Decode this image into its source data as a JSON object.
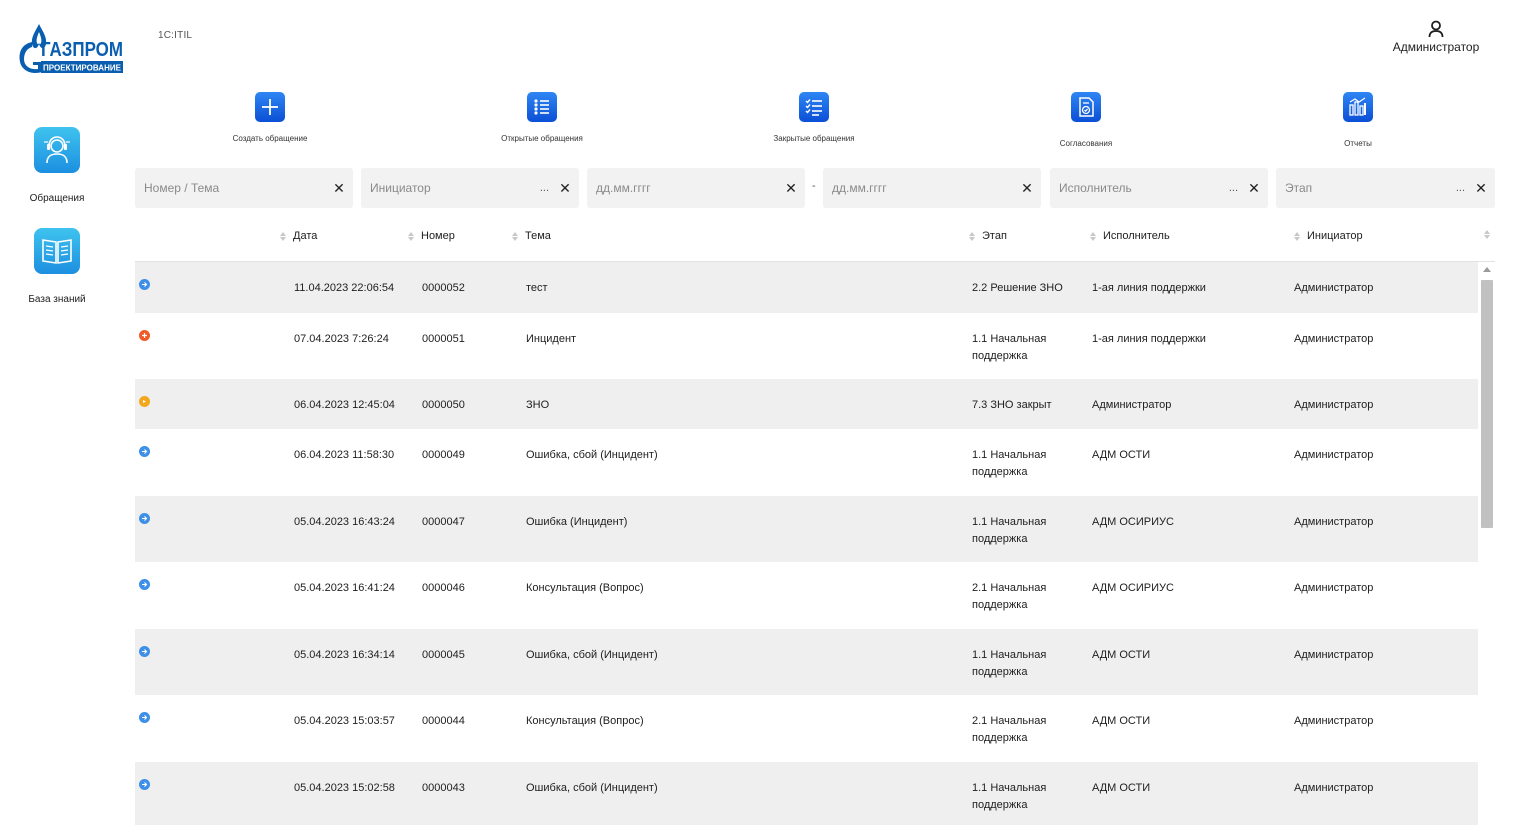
{
  "brand": {
    "logo_line1": "ГАЗПРОМ",
    "logo_line2": "ПРОЕКТИРОВАНИЕ",
    "logo_color": "#0a5eb0",
    "app_name": "1C:ITIL"
  },
  "user": {
    "name": "Администратор",
    "icon": "user-icon"
  },
  "sidebar": {
    "items": [
      {
        "label": "Обращения",
        "icon": "support-agent-icon"
      },
      {
        "label": "База знаний",
        "icon": "open-book-icon"
      }
    ]
  },
  "actions": [
    {
      "label": "Создать обращение",
      "icon": "plus-icon"
    },
    {
      "label": "Открытые обращения",
      "icon": "list-icon"
    },
    {
      "label": "Закрытые обращения",
      "icon": "checklist-icon"
    },
    {
      "label": "Согласования",
      "icon": "approval-document-icon"
    },
    {
      "label": "Отчеты",
      "icon": "bar-chart-icon"
    }
  ],
  "filters": {
    "number_topic": {
      "placeholder": "Номер / Тема"
    },
    "initiator": {
      "placeholder": "Инициатор"
    },
    "date_from": {
      "placeholder": "дд.мм.гггг"
    },
    "date_separator": "-",
    "date_to": {
      "placeholder": "дд.мм.гггг"
    },
    "executor": {
      "placeholder": "Исполнитель"
    },
    "stage": {
      "placeholder": "Этап"
    },
    "choose_label": "...",
    "clear_label": "✕"
  },
  "table": {
    "columns": [
      "Дата",
      "Номер",
      "Тема",
      "Этап",
      "Исполнитель",
      "Инициатор"
    ],
    "status_colors": {
      "blue": "#3d8fe8",
      "red": "#f05a28",
      "yellow": "#f2a81d"
    },
    "rows": [
      {
        "status": "blue",
        "date": "11.04.2023 22:06:54",
        "number": "0000052",
        "topic": "тест",
        "stage_line1": "2.2 Решение ЗНО",
        "stage_line2": "",
        "executor": "1-ая линия поддержки",
        "initiator": "Администратор"
      },
      {
        "status": "red",
        "date": "07.04.2023 7:26:24",
        "number": "0000051",
        "topic": "Инцидент",
        "stage_line1": "1.1 Начальная",
        "stage_line2": "поддержка",
        "executor": "1-ая линия поддержки",
        "initiator": "Администратор"
      },
      {
        "status": "yellow",
        "date": "06.04.2023 12:45:04",
        "number": "0000050",
        "topic": "ЗНО",
        "stage_line1": "7.3 ЗНО закрыт",
        "stage_line2": "",
        "executor": "Администратор",
        "initiator": "Администратор"
      },
      {
        "status": "blue",
        "date": "06.04.2023 11:58:30",
        "number": "0000049",
        "topic": "Ошибка, сбой (Инцидент)",
        "stage_line1": "1.1 Начальная",
        "stage_line2": "поддержка",
        "executor": "АДМ ОСТИ",
        "initiator": "Администратор"
      },
      {
        "status": "blue",
        "date": "05.04.2023 16:43:24",
        "number": "0000047",
        "topic": "Ошибка (Инцидент)",
        "stage_line1": "1.1 Начальная",
        "stage_line2": "поддержка",
        "executor": "АДМ ОСИРИУС",
        "initiator": "Администратор"
      },
      {
        "status": "blue",
        "date": "05.04.2023 16:41:24",
        "number": "0000046",
        "topic": "Консультация (Вопрос)",
        "stage_line1": "2.1 Начальная",
        "stage_line2": "поддержка",
        "executor": "АДМ ОСИРИУС",
        "initiator": "Администратор"
      },
      {
        "status": "blue",
        "date": "05.04.2023 16:34:14",
        "number": "0000045",
        "topic": "Ошибка, сбой (Инцидент)",
        "stage_line1": "1.1 Начальная",
        "stage_line2": "поддержка",
        "executor": "АДМ ОСТИ",
        "initiator": "Администратор"
      },
      {
        "status": "blue",
        "date": "05.04.2023 15:03:57",
        "number": "0000044",
        "topic": "Консультация (Вопрос)",
        "stage_line1": "2.1 Начальная",
        "stage_line2": "поддержка",
        "executor": "АДМ ОСТИ",
        "initiator": "Администратор"
      },
      {
        "status": "blue",
        "date": "05.04.2023 15:02:58",
        "number": "0000043",
        "topic": "Ошибка, сбой (Инцидент)",
        "stage_line1": "1.1 Начальная",
        "stage_line2": "поддержка",
        "executor": "АДМ ОСТИ",
        "initiator": "Администратор"
      }
    ]
  }
}
